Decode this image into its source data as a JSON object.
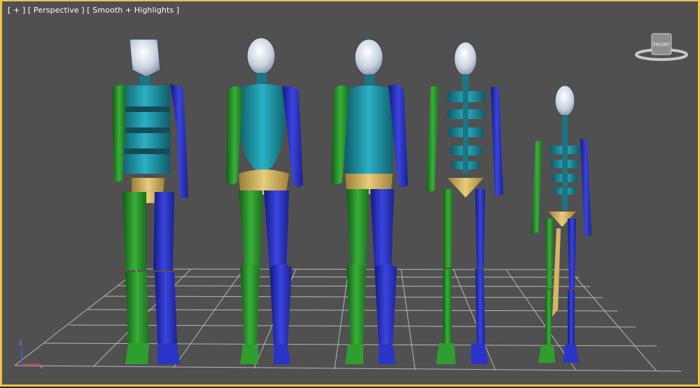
{
  "viewport": {
    "label": "[ + ] [ Perspective ] [ Smooth + Highlights ]",
    "background_color": "#505050",
    "active_border_color": "#f0c24a",
    "grid_color": "#b8b8b8"
  },
  "viewcube": {
    "face_label": "FRONT",
    "icon": "viewcube-icon"
  },
  "axis_gizmo": {
    "x_label": "x",
    "y_label": "y",
    "z_label": "z"
  },
  "figures": [
    {
      "name": "biped-figure-1",
      "description_icon": "biped-figure"
    },
    {
      "name": "biped-figure-2",
      "description_icon": "biped-figure"
    },
    {
      "name": "biped-figure-3",
      "description_icon": "biped-figure"
    },
    {
      "name": "biped-figure-4",
      "description_icon": "biped-figure"
    },
    {
      "name": "biped-figure-5",
      "description_icon": "biped-figure"
    }
  ],
  "colors": {
    "left_limb": "#2f9e2f",
    "right_limb": "#2b34c8",
    "torso": "#1e8fa0",
    "pelvis": "#d8b665",
    "head": "#dfe6f0",
    "fingers_left": "#d8b665",
    "fingers_right": "#b030b0"
  }
}
